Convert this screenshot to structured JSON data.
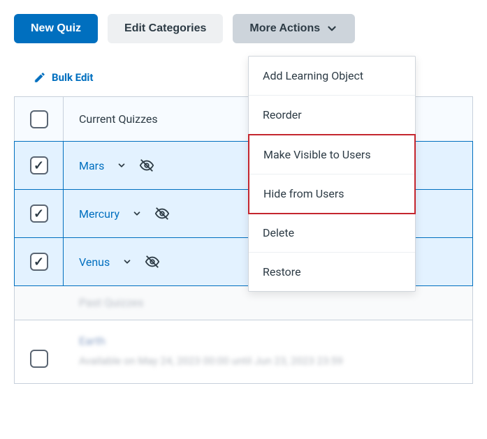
{
  "toolbar": {
    "new_quiz_label": "New Quiz",
    "edit_categories_label": "Edit Categories",
    "more_actions_label": "More Actions"
  },
  "bulk_edit_label": "Bulk Edit",
  "table": {
    "column_header": "Current Quizzes",
    "rows": [
      {
        "name": "Mars",
        "checked": true,
        "hidden": true
      },
      {
        "name": "Mercury",
        "checked": true,
        "hidden": true
      },
      {
        "name": "Venus",
        "checked": true,
        "hidden": true
      }
    ],
    "past_section_label": "Past Quizzes",
    "past_quiz_name": "Earth",
    "past_quiz_date": "Available on May 24, 2023 00:00 until Jun 23, 2023 23:59"
  },
  "dropdown": {
    "items": [
      "Add Learning Object",
      "Reorder",
      "Make Visible to Users",
      "Hide from Users",
      "Delete",
      "Restore"
    ]
  }
}
